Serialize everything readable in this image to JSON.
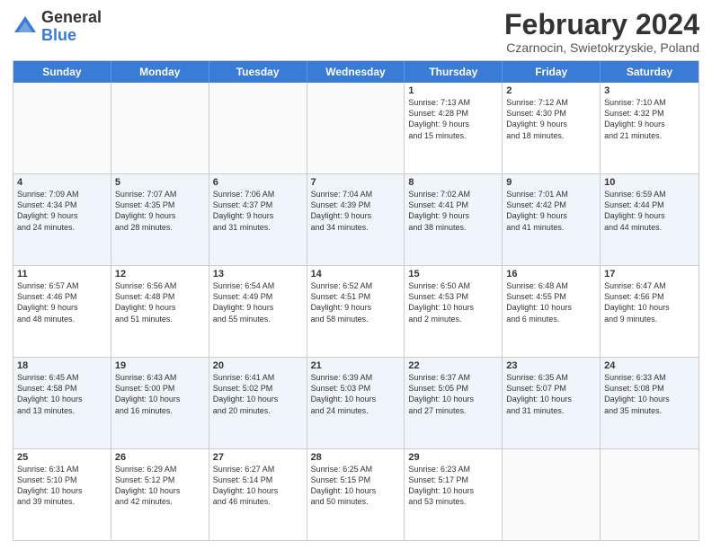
{
  "logo": {
    "general": "General",
    "blue": "Blue"
  },
  "title": "February 2024",
  "location": "Czarnocin, Swietokrzyskie, Poland",
  "days_of_week": [
    "Sunday",
    "Monday",
    "Tuesday",
    "Wednesday",
    "Thursday",
    "Friday",
    "Saturday"
  ],
  "weeks": [
    [
      {
        "day": "",
        "info": ""
      },
      {
        "day": "",
        "info": ""
      },
      {
        "day": "",
        "info": ""
      },
      {
        "day": "",
        "info": ""
      },
      {
        "day": "1",
        "info": "Sunrise: 7:13 AM\nSunset: 4:28 PM\nDaylight: 9 hours\nand 15 minutes."
      },
      {
        "day": "2",
        "info": "Sunrise: 7:12 AM\nSunset: 4:30 PM\nDaylight: 9 hours\nand 18 minutes."
      },
      {
        "day": "3",
        "info": "Sunrise: 7:10 AM\nSunset: 4:32 PM\nDaylight: 9 hours\nand 21 minutes."
      }
    ],
    [
      {
        "day": "4",
        "info": "Sunrise: 7:09 AM\nSunset: 4:34 PM\nDaylight: 9 hours\nand 24 minutes."
      },
      {
        "day": "5",
        "info": "Sunrise: 7:07 AM\nSunset: 4:35 PM\nDaylight: 9 hours\nand 28 minutes."
      },
      {
        "day": "6",
        "info": "Sunrise: 7:06 AM\nSunset: 4:37 PM\nDaylight: 9 hours\nand 31 minutes."
      },
      {
        "day": "7",
        "info": "Sunrise: 7:04 AM\nSunset: 4:39 PM\nDaylight: 9 hours\nand 34 minutes."
      },
      {
        "day": "8",
        "info": "Sunrise: 7:02 AM\nSunset: 4:41 PM\nDaylight: 9 hours\nand 38 minutes."
      },
      {
        "day": "9",
        "info": "Sunrise: 7:01 AM\nSunset: 4:42 PM\nDaylight: 9 hours\nand 41 minutes."
      },
      {
        "day": "10",
        "info": "Sunrise: 6:59 AM\nSunset: 4:44 PM\nDaylight: 9 hours\nand 44 minutes."
      }
    ],
    [
      {
        "day": "11",
        "info": "Sunrise: 6:57 AM\nSunset: 4:46 PM\nDaylight: 9 hours\nand 48 minutes."
      },
      {
        "day": "12",
        "info": "Sunrise: 6:56 AM\nSunset: 4:48 PM\nDaylight: 9 hours\nand 51 minutes."
      },
      {
        "day": "13",
        "info": "Sunrise: 6:54 AM\nSunset: 4:49 PM\nDaylight: 9 hours\nand 55 minutes."
      },
      {
        "day": "14",
        "info": "Sunrise: 6:52 AM\nSunset: 4:51 PM\nDaylight: 9 hours\nand 58 minutes."
      },
      {
        "day": "15",
        "info": "Sunrise: 6:50 AM\nSunset: 4:53 PM\nDaylight: 10 hours\nand 2 minutes."
      },
      {
        "day": "16",
        "info": "Sunrise: 6:48 AM\nSunset: 4:55 PM\nDaylight: 10 hours\nand 6 minutes."
      },
      {
        "day": "17",
        "info": "Sunrise: 6:47 AM\nSunset: 4:56 PM\nDaylight: 10 hours\nand 9 minutes."
      }
    ],
    [
      {
        "day": "18",
        "info": "Sunrise: 6:45 AM\nSunset: 4:58 PM\nDaylight: 10 hours\nand 13 minutes."
      },
      {
        "day": "19",
        "info": "Sunrise: 6:43 AM\nSunset: 5:00 PM\nDaylight: 10 hours\nand 16 minutes."
      },
      {
        "day": "20",
        "info": "Sunrise: 6:41 AM\nSunset: 5:02 PM\nDaylight: 10 hours\nand 20 minutes."
      },
      {
        "day": "21",
        "info": "Sunrise: 6:39 AM\nSunset: 5:03 PM\nDaylight: 10 hours\nand 24 minutes."
      },
      {
        "day": "22",
        "info": "Sunrise: 6:37 AM\nSunset: 5:05 PM\nDaylight: 10 hours\nand 27 minutes."
      },
      {
        "day": "23",
        "info": "Sunrise: 6:35 AM\nSunset: 5:07 PM\nDaylight: 10 hours\nand 31 minutes."
      },
      {
        "day": "24",
        "info": "Sunrise: 6:33 AM\nSunset: 5:08 PM\nDaylight: 10 hours\nand 35 minutes."
      }
    ],
    [
      {
        "day": "25",
        "info": "Sunrise: 6:31 AM\nSunset: 5:10 PM\nDaylight: 10 hours\nand 39 minutes."
      },
      {
        "day": "26",
        "info": "Sunrise: 6:29 AM\nSunset: 5:12 PM\nDaylight: 10 hours\nand 42 minutes."
      },
      {
        "day": "27",
        "info": "Sunrise: 6:27 AM\nSunset: 5:14 PM\nDaylight: 10 hours\nand 46 minutes."
      },
      {
        "day": "28",
        "info": "Sunrise: 6:25 AM\nSunset: 5:15 PM\nDaylight: 10 hours\nand 50 minutes."
      },
      {
        "day": "29",
        "info": "Sunrise: 6:23 AM\nSunset: 5:17 PM\nDaylight: 10 hours\nand 53 minutes."
      },
      {
        "day": "",
        "info": ""
      },
      {
        "day": "",
        "info": ""
      }
    ]
  ]
}
